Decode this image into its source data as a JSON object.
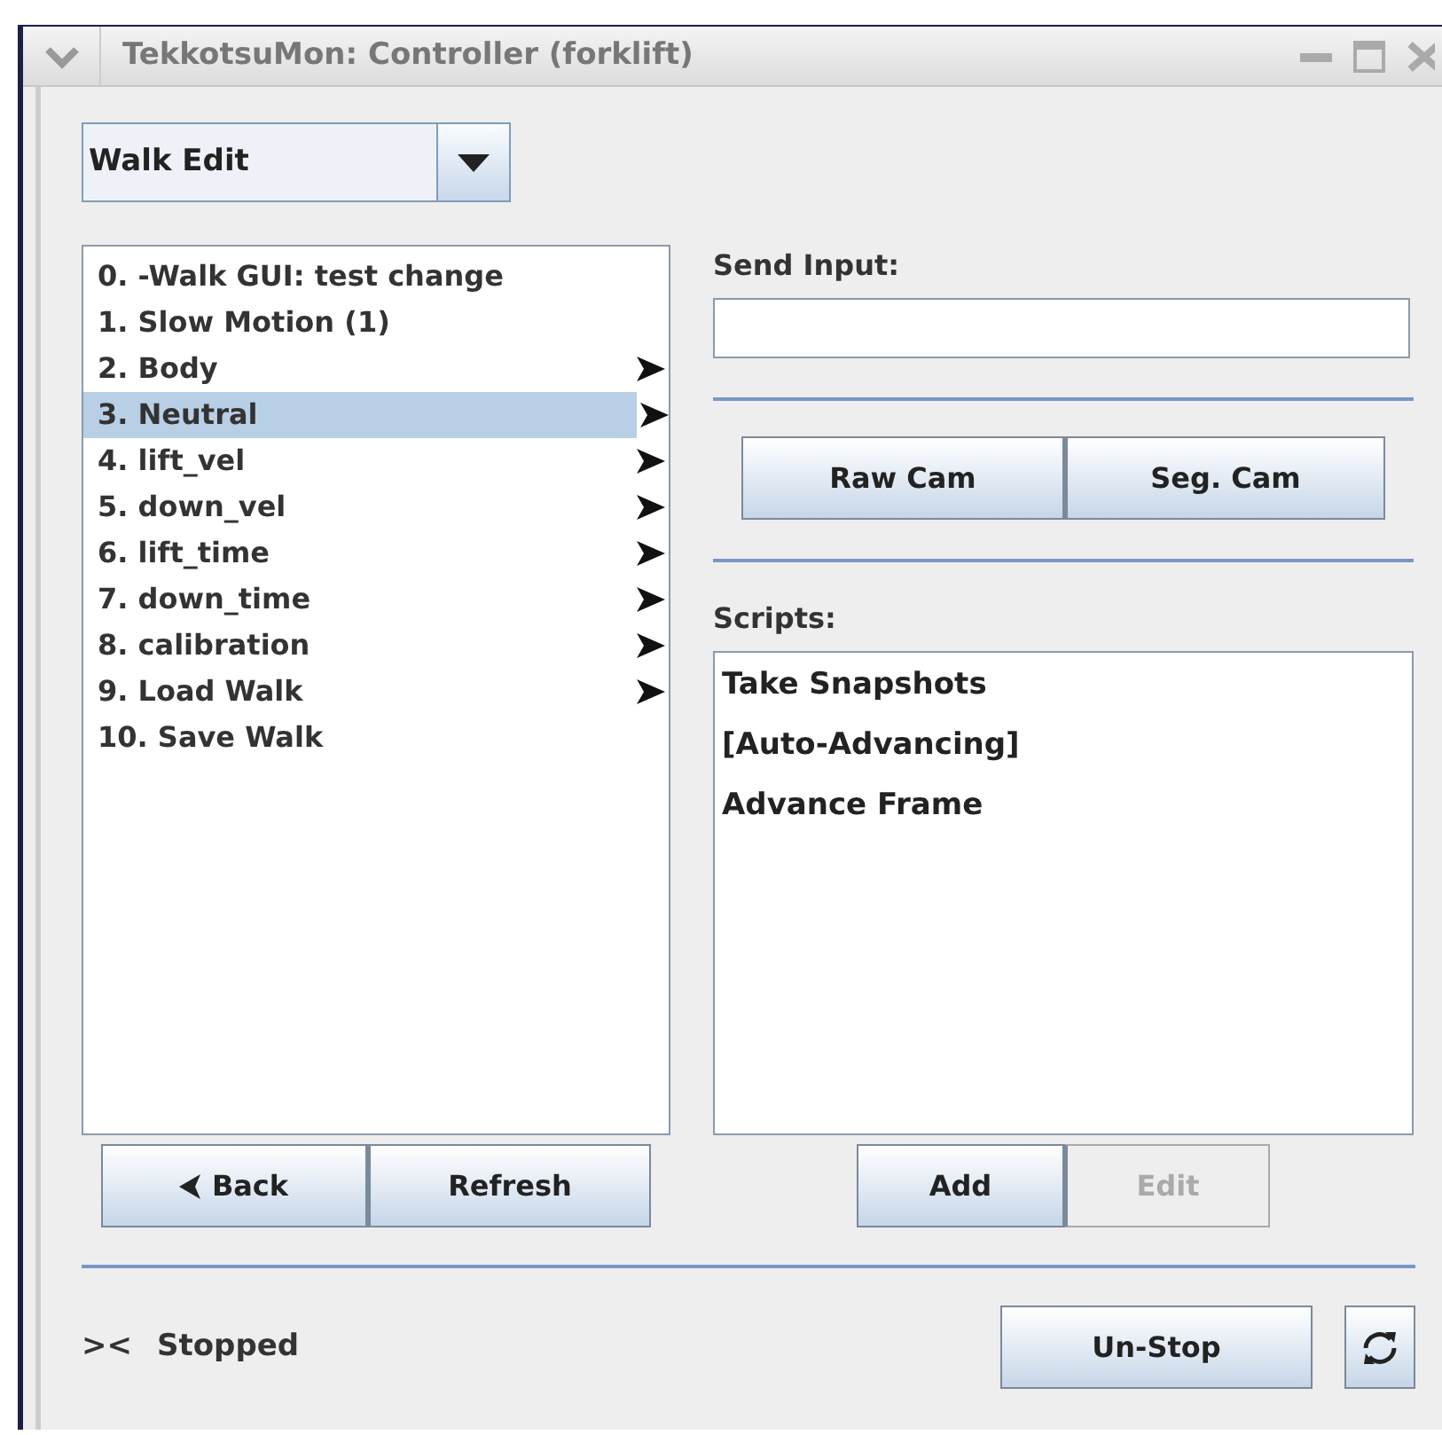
{
  "window": {
    "title": "TekkotsuMon: Controller (forklift)"
  },
  "mode_dropdown": {
    "value": "Walk Edit"
  },
  "menu_list": {
    "items": [
      {
        "label": "0. -Walk GUI: test change",
        "selected": false,
        "has_submenu": false
      },
      {
        "label": "1. Slow Motion (1)",
        "selected": false,
        "has_submenu": false
      },
      {
        "label": "2. Body",
        "selected": false,
        "has_submenu": true
      },
      {
        "label": "3. Neutral",
        "selected": true,
        "has_submenu": true
      },
      {
        "label": "4. lift_vel",
        "selected": false,
        "has_submenu": true
      },
      {
        "label": "5. down_vel",
        "selected": false,
        "has_submenu": true
      },
      {
        "label": "6. lift_time",
        "selected": false,
        "has_submenu": true
      },
      {
        "label": "7. down_time",
        "selected": false,
        "has_submenu": true
      },
      {
        "label": "8. calibration",
        "selected": false,
        "has_submenu": true
      },
      {
        "label": "9. Load Walk",
        "selected": false,
        "has_submenu": true
      },
      {
        "label": "10. Save Walk",
        "selected": false,
        "has_submenu": false
      }
    ]
  },
  "menu_buttons": [
    {
      "label": "Back",
      "kind": "back",
      "disabled": false
    },
    {
      "label": "Refresh",
      "kind": "plain",
      "disabled": false
    }
  ],
  "send_input": {
    "label": "Send Input:"
  },
  "camera_buttons": [
    {
      "label": "Raw Cam",
      "disabled": false
    },
    {
      "label": "Seg. Cam",
      "disabled": false
    }
  ],
  "scripts": {
    "label": "Scripts:",
    "items": [
      "Take Snapshots",
      "[Auto-Advancing]",
      "Advance Frame"
    ]
  },
  "script_buttons": [
    {
      "label": "Add",
      "disabled": false
    },
    {
      "label": "Edit",
      "disabled": true
    }
  ],
  "status": {
    "indicator": "><",
    "text": "Stopped"
  },
  "unstop_button": {
    "label": "Un-Stop"
  }
}
